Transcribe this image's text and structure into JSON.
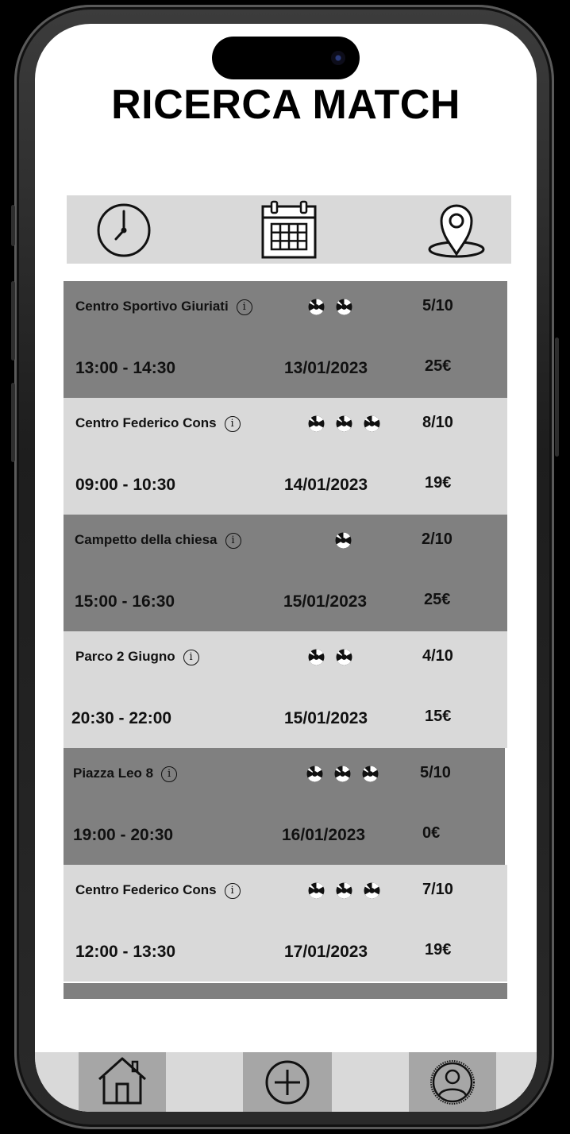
{
  "page": {
    "title": "RICERCA MATCH"
  },
  "filters": [
    {
      "name": "time-filter",
      "icon": "clock-icon"
    },
    {
      "name": "date-filter",
      "icon": "calendar-icon"
    },
    {
      "name": "location-filter",
      "icon": "location-pin-icon"
    }
  ],
  "matches": [
    {
      "venue": "Centro Sportivo Giuriati",
      "balls": 2,
      "players": "5/10",
      "time": "13:00 - 14:30",
      "date": "13/01/2023",
      "price": "25€",
      "shade": "dark"
    },
    {
      "venue": "Centro Federico Cons",
      "balls": 3,
      "players": "8/10",
      "time": "09:00 - 10:30",
      "date": "14/01/2023",
      "price": "19€",
      "shade": "light"
    },
    {
      "venue": "Campetto della chiesa",
      "balls": 1,
      "players": "2/10",
      "time": "15:00 - 16:30",
      "date": "15/01/2023",
      "price": "25€",
      "shade": "dark"
    },
    {
      "venue": "Parco 2 Giugno",
      "balls": 2,
      "players": "4/10",
      "time": "20:30 - 22:00",
      "date": "15/01/2023",
      "price": "15€",
      "shade": "light"
    },
    {
      "venue": "Piazza Leo 8",
      "balls": 3,
      "players": "5/10",
      "time": "19:00 - 20:30",
      "date": "16/01/2023",
      "price": "0€",
      "shade": "dark"
    },
    {
      "venue": "Centro Federico Cons",
      "balls": 3,
      "players": "7/10",
      "time": "12:00 - 13:30",
      "date": "17/01/2023",
      "price": "19€",
      "shade": "light"
    }
  ],
  "nav": [
    {
      "name": "nav-home",
      "icon": "home-icon"
    },
    {
      "name": "nav-add",
      "icon": "plus-circle-icon"
    },
    {
      "name": "nav-profile",
      "icon": "profile-icon"
    }
  ],
  "colors": {
    "dark_row": "#808080",
    "light_row": "#d9d9d9",
    "nav_active": "#a6a6a6"
  }
}
